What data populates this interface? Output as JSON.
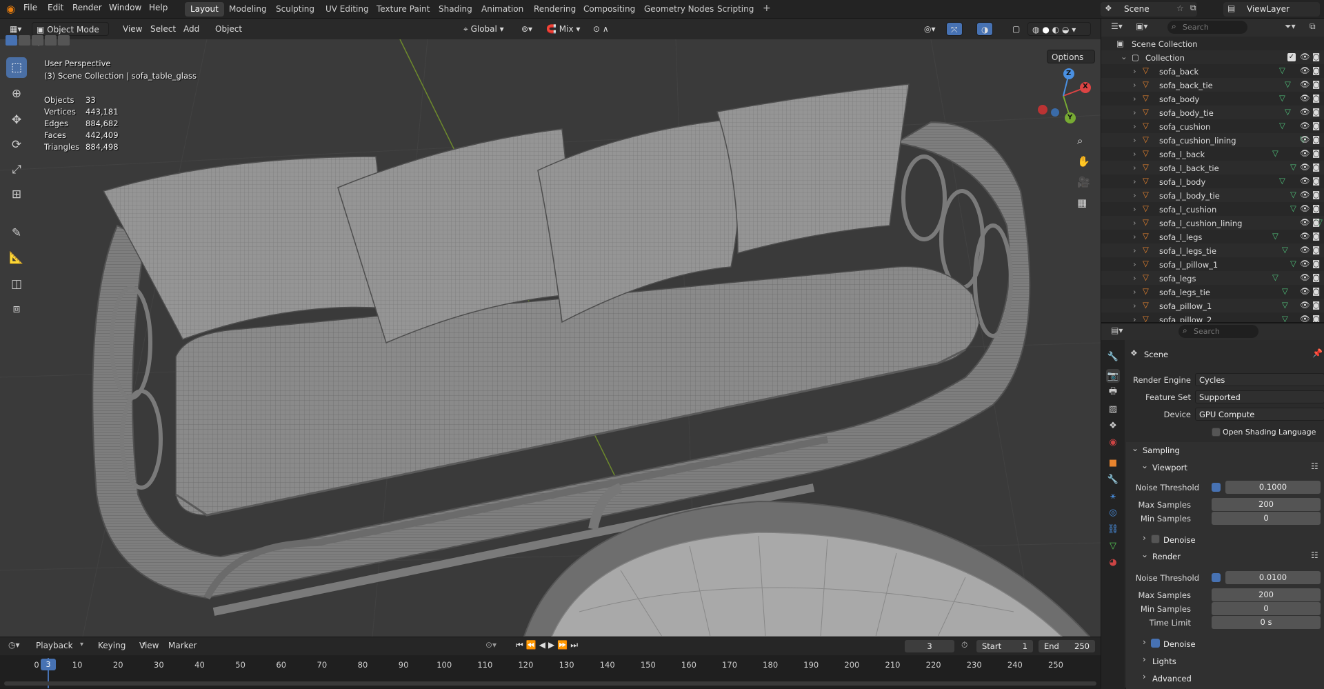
{
  "menu": [
    "File",
    "Edit",
    "Render",
    "Window",
    "Help"
  ],
  "workspaces": [
    {
      "label": "Layout",
      "active": true
    },
    {
      "label": "Modeling"
    },
    {
      "label": "Sculpting"
    },
    {
      "label": "UV Editing"
    },
    {
      "label": "Texture Paint"
    },
    {
      "label": "Shading"
    },
    {
      "label": "Animation"
    },
    {
      "label": "Rendering"
    },
    {
      "label": "Compositing"
    },
    {
      "label": "Geometry Nodes"
    },
    {
      "label": "Scripting"
    }
  ],
  "scene_name": "Scene",
  "view_layer": "ViewLayer",
  "viewport": {
    "mode": "Object Mode",
    "menus": [
      "View",
      "Select",
      "Add",
      "Object"
    ],
    "orientation": "Global",
    "snap_mode": "Mix",
    "options_label": "Options",
    "perspective": "User Perspective",
    "context": "(3) Scene Collection | sofa_table_glass",
    "stats": [
      {
        "label": "Objects",
        "value": "33"
      },
      {
        "label": "Vertices",
        "value": "443,181"
      },
      {
        "label": "Edges",
        "value": "884,682"
      },
      {
        "label": "Faces",
        "value": "442,409"
      },
      {
        "label": "Triangles",
        "value": "884,498"
      }
    ],
    "gizmo": {
      "x": "X",
      "y": "Y",
      "z": "Z"
    }
  },
  "outliner": {
    "search_placeholder": "Search",
    "root": "Scene Collection",
    "collection": "Collection",
    "items": [
      "sofa_back",
      "sofa_back_tie",
      "sofa_body",
      "sofa_body_tie",
      "sofa_cushion",
      "sofa_cushion_lining",
      "sofa_l_back",
      "sofa_l_back_tie",
      "sofa_l_body",
      "sofa_l_body_tie",
      "sofa_l_cushion",
      "sofa_l_cushion_lining",
      "sofa_l_legs",
      "sofa_l_legs_tie",
      "sofa_l_pillow_1",
      "sofa_legs",
      "sofa_legs_tie",
      "sofa_pillow_1",
      "sofa_pillow_2"
    ]
  },
  "properties": {
    "search_placeholder": "Search",
    "context": "Scene",
    "render_engine": {
      "label": "Render Engine",
      "value": "Cycles"
    },
    "feature_set": {
      "label": "Feature Set",
      "value": "Supported"
    },
    "device": {
      "label": "Device",
      "value": "GPU Compute"
    },
    "osl": "Open Shading Language",
    "sampling": "Sampling",
    "viewport_sub": "Viewport",
    "vp_noise": {
      "label": "Noise Threshold",
      "value": "0.1000"
    },
    "vp_max": {
      "label": "Max Samples",
      "value": "200"
    },
    "vp_min": {
      "label": "Min Samples",
      "value": "0"
    },
    "vp_denoise": "Denoise",
    "render_sub": "Render",
    "r_noise": {
      "label": "Noise Threshold",
      "value": "0.0100"
    },
    "r_max": {
      "label": "Max Samples",
      "value": "200"
    },
    "r_min": {
      "label": "Min Samples",
      "value": "0"
    },
    "r_time": {
      "label": "Time Limit",
      "value": "0 s"
    },
    "r_denoise": "Denoise",
    "lights": "Lights",
    "advanced": "Advanced"
  },
  "timeline": {
    "menus": [
      "Playback",
      "Keying",
      "View",
      "Marker"
    ],
    "current_frame": "3",
    "start_label": "Start",
    "start": "1",
    "end_label": "End",
    "end": "250",
    "ticks": [
      "0",
      "10",
      "20",
      "30",
      "40",
      "50",
      "60",
      "70",
      "80",
      "90",
      "100",
      "110",
      "120",
      "130",
      "140",
      "150",
      "160",
      "170",
      "180",
      "190",
      "200",
      "210",
      "220",
      "230",
      "240",
      "250"
    ]
  }
}
